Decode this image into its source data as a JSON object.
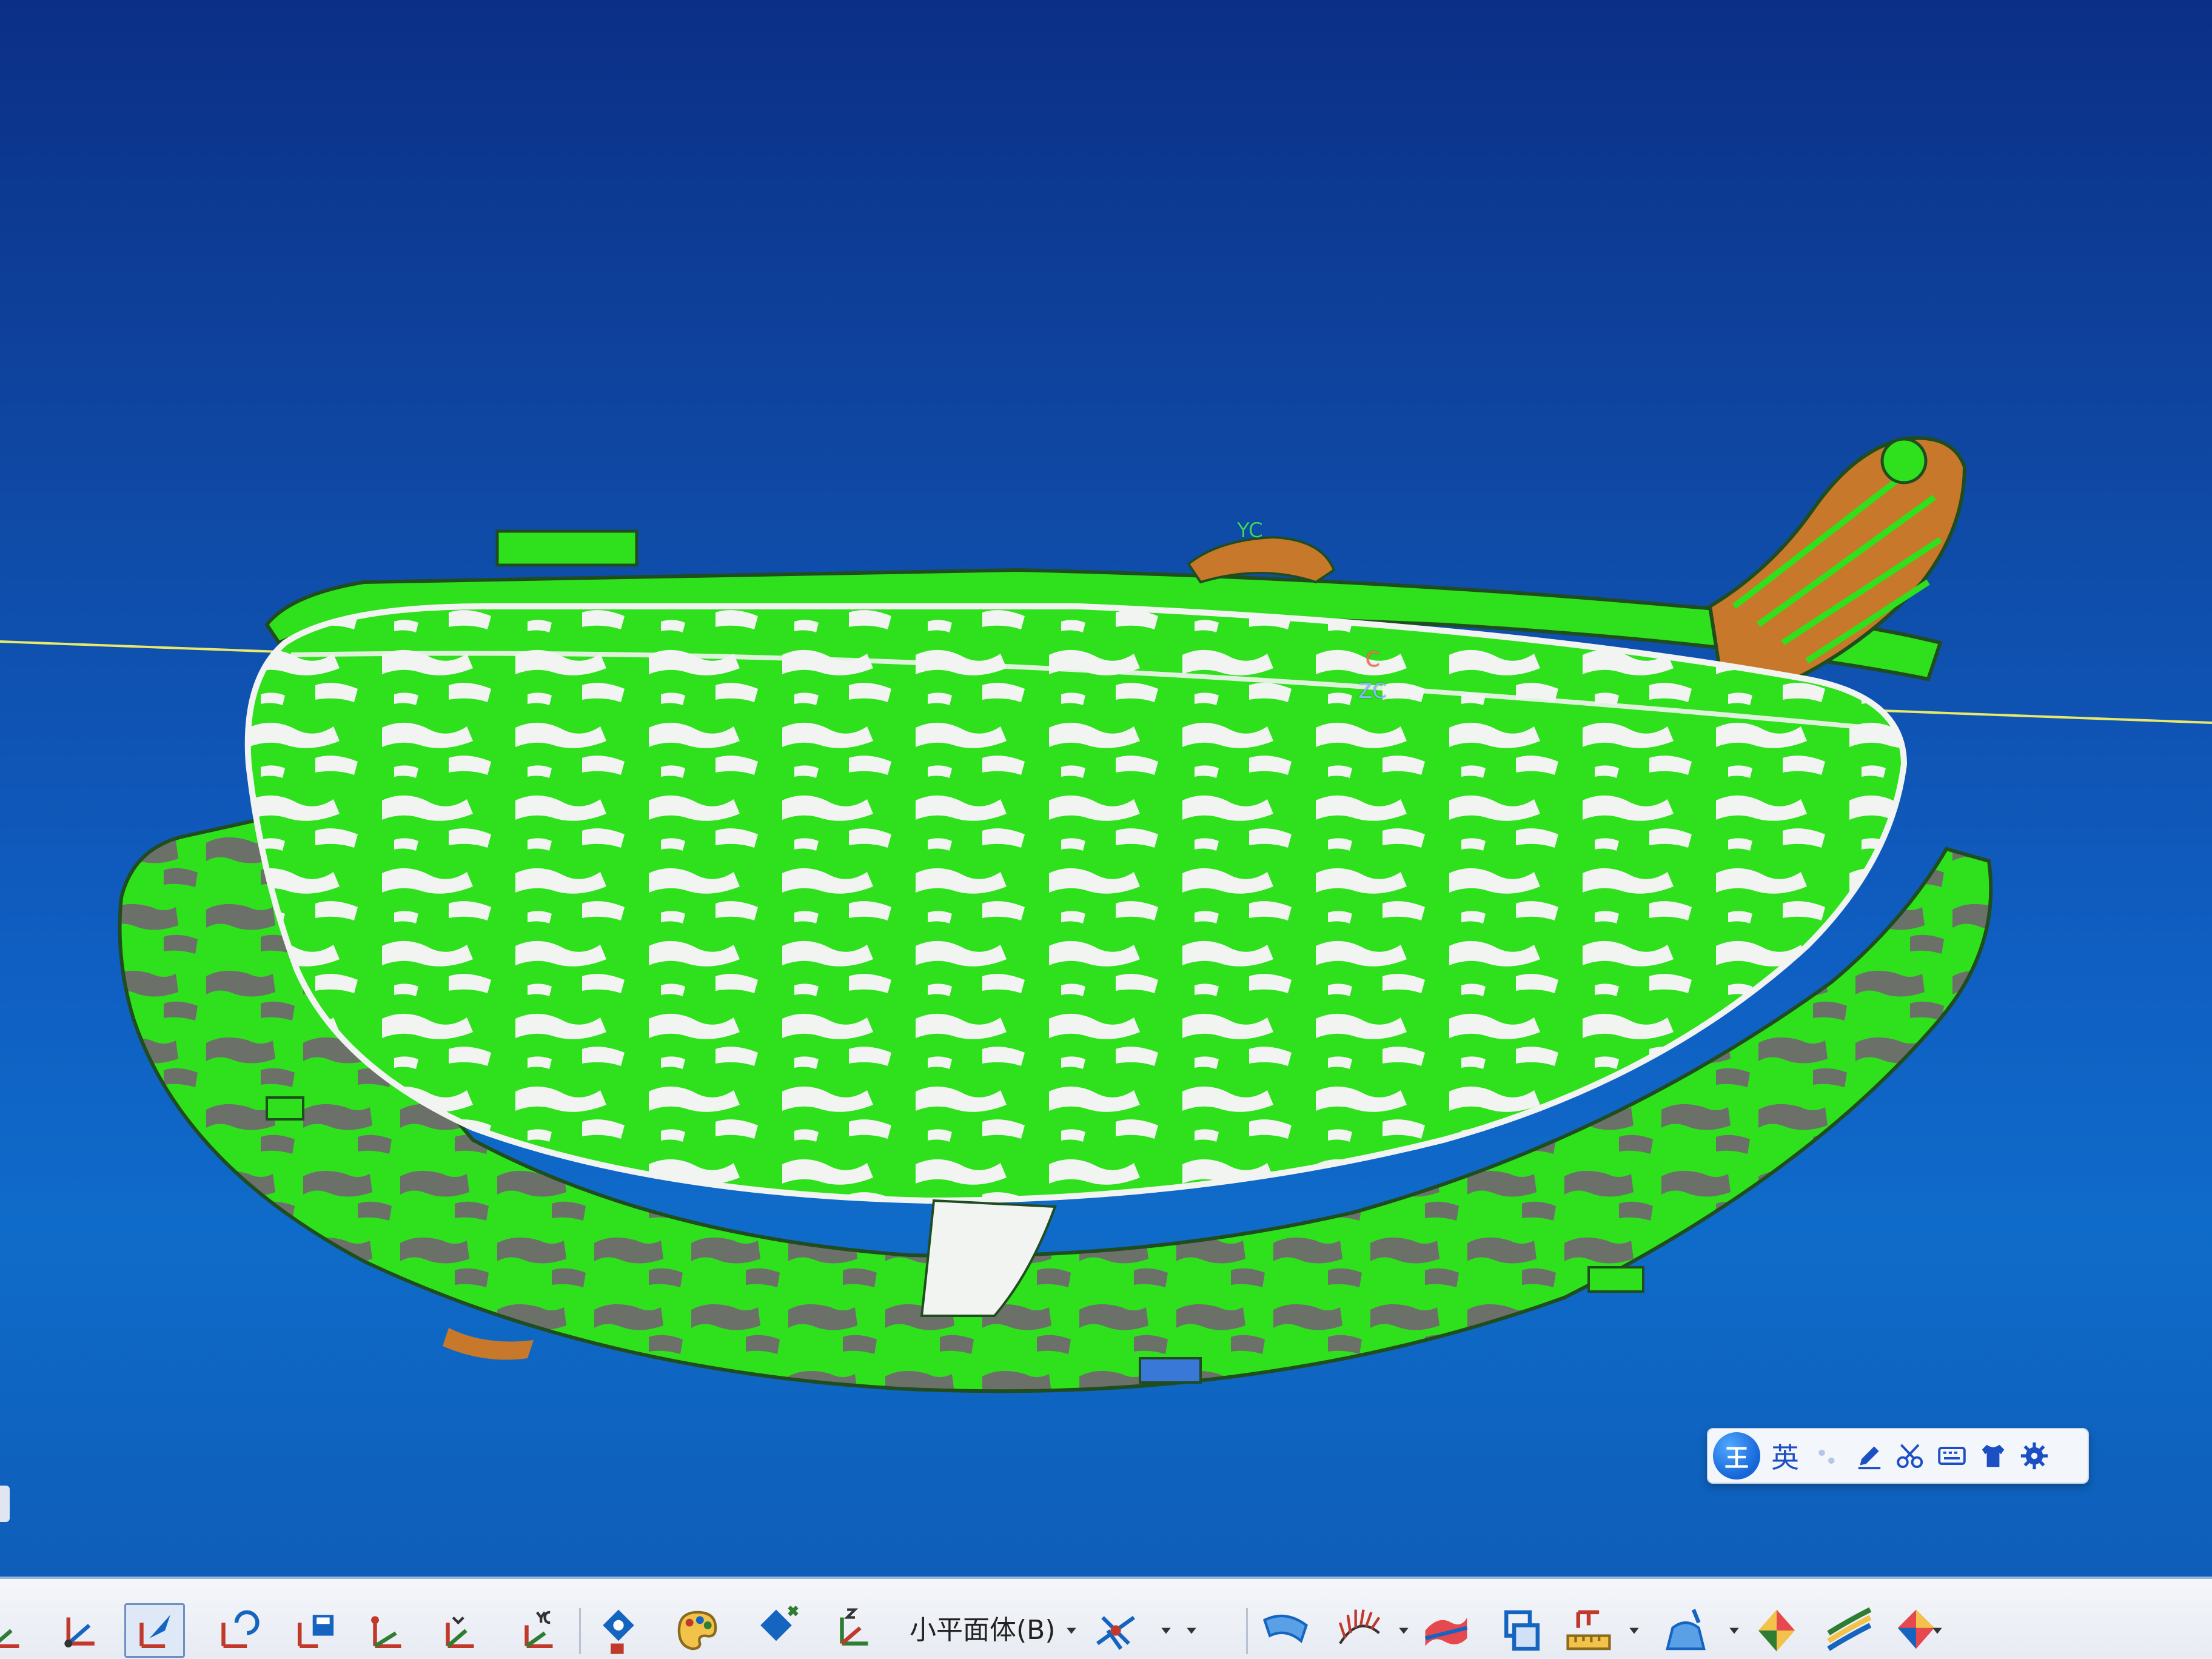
{
  "viewport": {
    "background_top": "#0b2f86",
    "background_bottom": "#0f6bc9",
    "model_colors": {
      "surface_green": "#2fe01c",
      "highlight_white": "#f2f4f2",
      "shadow_gray": "#6b7069",
      "bracket_orange": "#c8782a",
      "outline_dark": "#1f4d1f"
    },
    "axis_labels": {
      "yc": "YC",
      "zc": "ZC",
      "x": "C"
    }
  },
  "ime": {
    "logo_text": "王",
    "mode_text": "英",
    "icons": [
      "punctuation-icon",
      "pen-icon",
      "scissors-icon",
      "keyboard-icon",
      "skin-icon",
      "gear-icon"
    ],
    "accent": "#1c4fc3"
  },
  "toolbar": {
    "left_buttons": [
      "csys-icon",
      "csys-origin-icon",
      "csys-dynamic-icon",
      "rotate-csys-icon",
      "save-csys-icon",
      "point-csys-icon",
      "yc-xc-plane-icon",
      "yc-csys-icon",
      "view-orient-icon",
      "paint-palette-icon",
      "show-hide-icon",
      "zyx-axes-icon"
    ],
    "facet_filter_label": "小平面体(B)",
    "right_buttons": [
      "snap-point-icon",
      "curve-surface-icon",
      "comb-analysis-icon",
      "face-curvature-icon",
      "deviation-icon",
      "measure-ruler-icon",
      "draft-analysis-icon",
      "reflection-analysis-icon",
      "zebra-stripes-icon",
      "color-map-icon"
    ]
  }
}
